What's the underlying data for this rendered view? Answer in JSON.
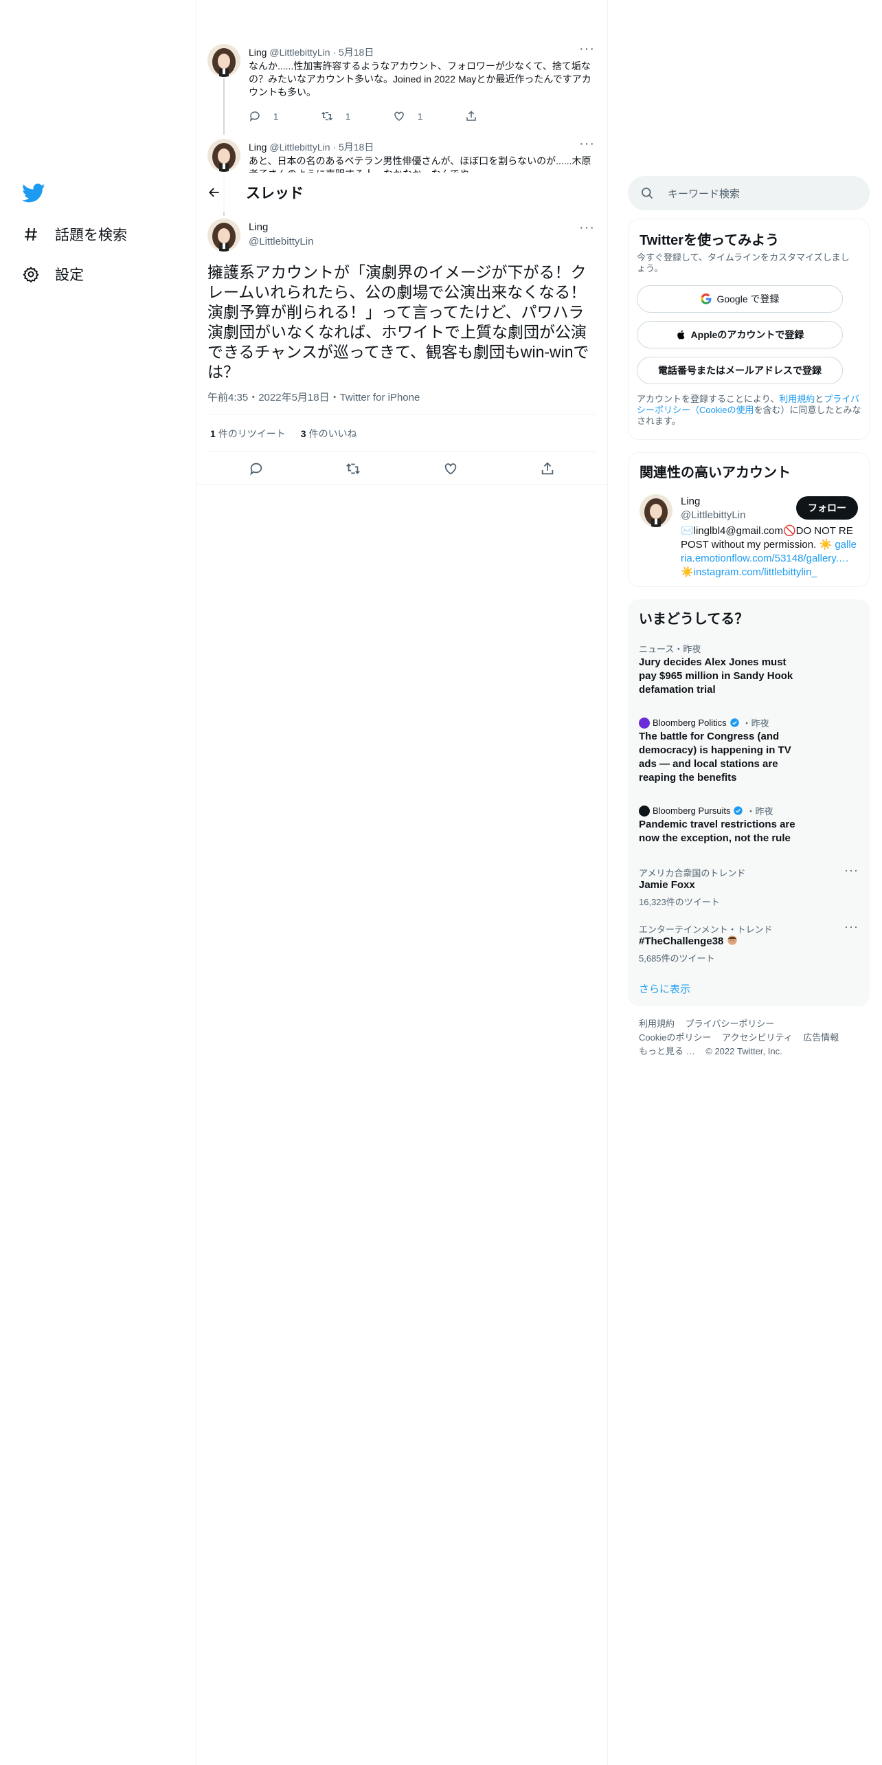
{
  "nav": {
    "logo": "twitter-bird-icon",
    "items": [
      {
        "label": "話題を検索",
        "icon": "hashtag-icon"
      },
      {
        "label": "設定",
        "icon": "gear-icon"
      }
    ]
  },
  "thread": {
    "header_title": "スレッド",
    "replies": [
      {
        "name": "Ling",
        "handle": "@LittlebittyLin",
        "date": "5月18日",
        "text": "なんか......性加害許容するようなアカウント、フォロワーが少なくて、捨て垢なの？みたいなアカウント多いな。Joined in 2022 Mayとか最近作ったんですアカウントも多い。",
        "reply_count": "1",
        "retweet_count": "1",
        "like_count": "1"
      },
      {
        "name": "Ling",
        "handle": "@LittlebittyLin",
        "date": "5月18日",
        "text": "あと、日本の名のあるベテラン男性俳優さんが、ほぼ口を割らないのが......木原孝子さんのように声明する人、なかなか、なんでや"
      }
    ],
    "focus": {
      "name": "Ling",
      "handle": "@LittlebittyLin",
      "text": "擁護系アカウントが「演劇界のイメージが下がる！クレームいれられたら、公の劇場で公演出来なくなる！演劇予算が削られる！」って言ってたけど、パワハラ演劇団がいなくなれば、ホワイトで上質な劇団が公演できるチャンスが巡ってきて、観客も劇団もwin-winでは？",
      "time": "午前4:35・2022年5月18日・Twitter for iPhone",
      "retweets_num": "1",
      "retweets_label": "件のリツイート",
      "likes_num": "3",
      "likes_label": "件のいいね"
    }
  },
  "search": {
    "placeholder": "キーワード検索"
  },
  "signup": {
    "title": "Twitterを使ってみよう",
    "subtitle": "今すぐ登録して、タイムラインをカスタマイズしましょう。",
    "google": "Google で登録",
    "apple": "Appleのアカウントで登録",
    "phone": "電話番号またはメールアドレスで登録",
    "terms_pre": "アカウントを登録することにより、",
    "terms_link1": "利用規約",
    "terms_mid1": "と",
    "terms_link2": "プライバシーポリシー（Cookieの使用",
    "terms_post": "を含む）に同意したとみなされます。"
  },
  "related": {
    "title": "関連性の高いアカウント",
    "name": "Ling",
    "handle": "@LittlebittyLin",
    "follow": "フォロー",
    "bio_text": "✉️linglbl4@gmail.com🚫DO NOT REPOST without my permission. ☀️",
    "bio_link1": "galleria.emotionflow.com/53148/gallery.…",
    "bio_mid": " ☀️",
    "bio_link2": "instagram.com/littlebittylin_"
  },
  "trends": {
    "title": "いまどうしてる？",
    "items": [
      {
        "context": "ニュース・昨夜",
        "title": "Jury decides Alex Jones must pay $965 million in Sandy Hook defamation trial"
      },
      {
        "source": "Bloomberg Politics",
        "time": "・昨夜",
        "title": "The battle for Congress (and democracy) is happening in TV ads — and local stations are reaping the benefits"
      },
      {
        "source": "Bloomberg Pursuits",
        "time": "・昨夜",
        "title": "Pandemic travel restrictions are now the exception, not the rule"
      },
      {
        "context": "アメリカ合衆国のトレンド",
        "title": "Jamie Foxx",
        "count": "16,323件のツイート"
      },
      {
        "context": "エンターテインメント・トレンド",
        "title": "#TheChallenge38",
        "count": "5,685件のツイート"
      }
    ],
    "show_more": "さらに表示"
  },
  "footer": {
    "links": [
      "利用規約",
      "プライバシーポリシー",
      "Cookieのポリシー",
      "アクセシビリティ",
      "広告情報",
      "もっと見る …"
    ],
    "copyright": "© 2022 Twitter, Inc."
  },
  "colors": {
    "accent": "#1d9bf0",
    "text": "#0f1419",
    "secondary": "#536471",
    "border": "#eff3f4"
  }
}
